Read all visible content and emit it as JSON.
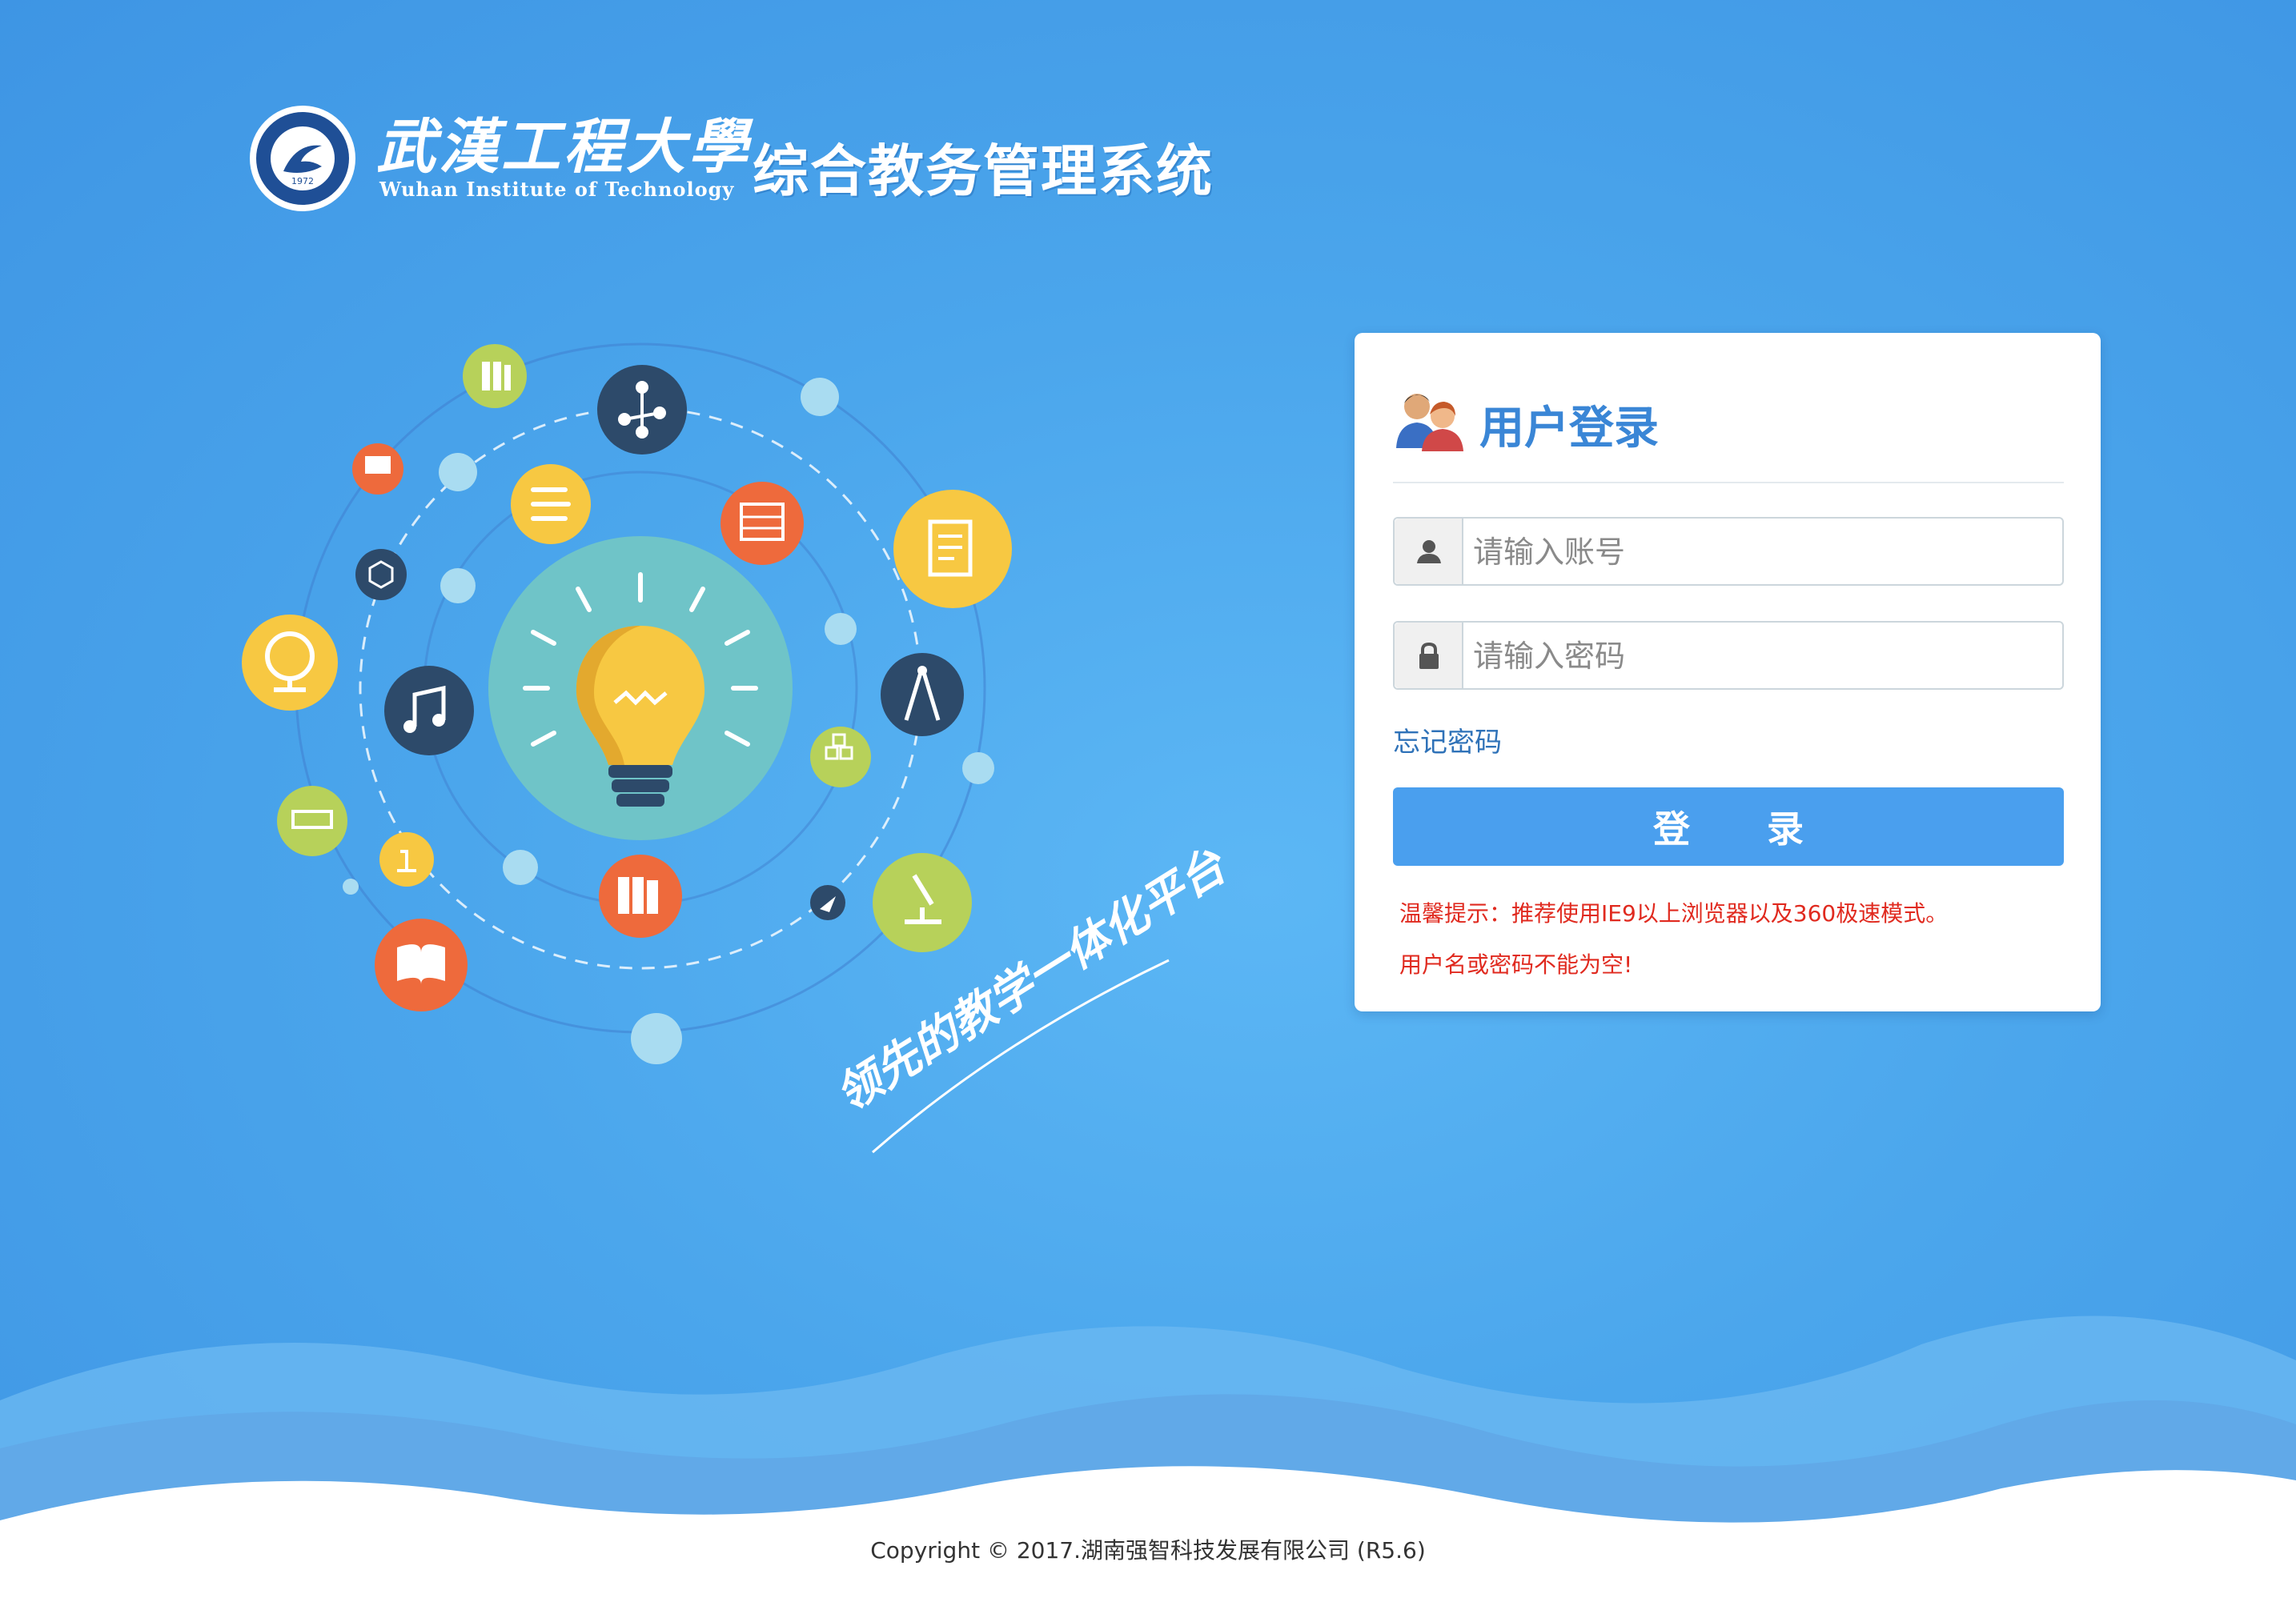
{
  "header": {
    "school_name_cn": "武漢工程大學",
    "school_name_en": "Wuhan Institute of Technology",
    "seal_year": "1972",
    "system_title": "综合教务管理系统"
  },
  "illustration": {
    "slogan": "领先的教学一体化平台"
  },
  "login": {
    "title": "用户登录",
    "username_placeholder": "请输入账号",
    "password_placeholder": "请输入密码",
    "forgot_password": "忘记密码",
    "login_button": "登 录",
    "tip": "温馨提示：推荐使用IE9以上浏览器以及360极速模式。",
    "error": "用户名或密码不能为空!"
  },
  "footer": {
    "copyright": "Copyright © 2017.湖南强智科技发展有限公司 (R5.6)"
  },
  "colors": {
    "background": "#4ba6ec",
    "accent": "#4a9fee",
    "title": "#3a86d6",
    "error": "#e02a1f"
  },
  "icons": [
    "user-icon",
    "lock-icon",
    "users-icon",
    "lightbulb-icon"
  ]
}
